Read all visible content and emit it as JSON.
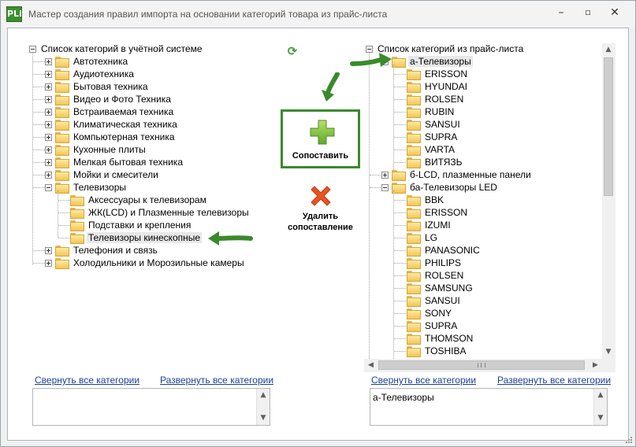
{
  "window": {
    "icon_text": "PLi",
    "title": "Мастер создания правил импорта на основании категорий товара из прайс-листа",
    "minimize": "–",
    "maximize": "▫",
    "close": "✕"
  },
  "left_tree": {
    "root_label": "Список категорий в учётной системе",
    "items": [
      {
        "label": "Автотехника",
        "state": "collapsed"
      },
      {
        "label": "Аудиотехника",
        "state": "collapsed"
      },
      {
        "label": "Бытовая техника",
        "state": "collapsed"
      },
      {
        "label": "Видео и Фото Техника",
        "state": "collapsed"
      },
      {
        "label": "Встраиваемая техника",
        "state": "collapsed"
      },
      {
        "label": "Климатическая техника",
        "state": "collapsed"
      },
      {
        "label": "Компьютерная техника",
        "state": "collapsed"
      },
      {
        "label": "Кухонные плиты",
        "state": "collapsed"
      },
      {
        "label": "Мелкая бытовая техника",
        "state": "collapsed"
      },
      {
        "label": "Мойки и смесители",
        "state": "collapsed"
      },
      {
        "label": "Телевизоры",
        "state": "expanded"
      },
      {
        "label": "Аксессуары к телевизорам",
        "state": "leaf"
      },
      {
        "label": "ЖК(LCD) и Плазменные телевизоры",
        "state": "leaf"
      },
      {
        "label": "Подставки и крепления",
        "state": "leaf"
      },
      {
        "label": "Телевизоры кинескопные",
        "state": "leaf",
        "selected": true
      },
      {
        "label": "Телефония и связь",
        "state": "collapsed"
      },
      {
        "label": "Холодильники и Морозильные камеры",
        "state": "collapsed"
      }
    ],
    "collapse_all_link": "Свернуть все категории",
    "expand_all_link": "Развернуть все категории",
    "selection_box_value": ""
  },
  "middle": {
    "refresh_icon": "refresh-icon",
    "match_button_label": "Сопоставить",
    "delete_button_label_line1": "Удалить",
    "delete_button_label_line2": "сопоставление"
  },
  "right_tree": {
    "root_label": "Список категорий из прайс-листа",
    "groups": [
      {
        "label": "а-Телевизоры",
        "state": "expanded",
        "selected": true,
        "children": [
          "ERISSON",
          "HYUNDAI",
          "ROLSEN",
          "RUBIN",
          "SANSUI",
          "SUPRA",
          "VARTA",
          "ВИТЯЗЬ"
        ]
      },
      {
        "label": "б-LCD, плазменные панели",
        "state": "collapsed",
        "children": []
      },
      {
        "label": "ба-Телевизоры LED",
        "state": "expanded",
        "children": [
          "BBK",
          "ERISSON",
          "IZUMI",
          "LG",
          "PANASONIC",
          "PHILIPS",
          "ROLSEN",
          "SAMSUNG",
          "SANSUI",
          "SONY",
          "SUPRA",
          "THOMSON",
          "TOSHIBA"
        ]
      }
    ],
    "collapse_all_link": "Свернуть все категории",
    "expand_all_link": "Развернуть все категории",
    "selection_box_value": "а-Телевизоры"
  },
  "colors": {
    "accent_green": "#3a8a2c",
    "link_blue": "#1a3f9c",
    "delete_orange": "#e8531f"
  }
}
